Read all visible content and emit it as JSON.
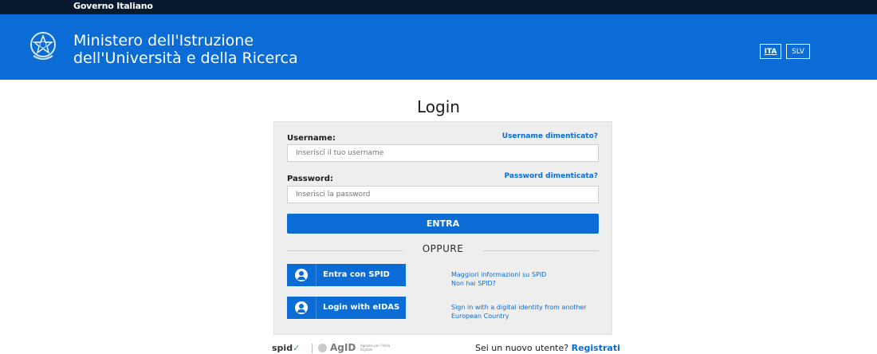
{
  "top_strip": {
    "label": "Governo Italiano"
  },
  "header": {
    "ministry_line1": "Ministero dell'Istruzione",
    "ministry_line2": "dell'Università e della Ricerca",
    "languages": [
      "ITA",
      "SLV"
    ],
    "emblem": "emblem-icon"
  },
  "login": {
    "title": "Login",
    "username_label": "Username:",
    "username_forgot": "Username dimenticato?",
    "username_placeholder": "Inserisci il tuo username",
    "password_label": "Password:",
    "password_forgot": "Password dimenticata?",
    "password_placeholder": "Inserisci la password",
    "submit_label": "ENTRA",
    "divider_label": "OPPURE",
    "spid_button": "Entra con SPID",
    "spid_info_1": "Maggiori informazioni su SPID",
    "spid_info_2": "Non hai SPID?",
    "eidas_button": "Login with eIDAS",
    "eidas_info_1": "Sign in with a digital identity from another",
    "eidas_info_2": "European Country"
  },
  "footer": {
    "spid_logo": "spid",
    "agid_logo": "AgID",
    "agid_sub": "Agenzia per l'Italia Digitale",
    "new_user_text": "Sei un nuovo utente?",
    "register_link": "Registrati"
  },
  "colors": {
    "header_blue": "#0b6cd6",
    "top_strip": "#06192f",
    "panel_bg": "#eeeeee"
  }
}
